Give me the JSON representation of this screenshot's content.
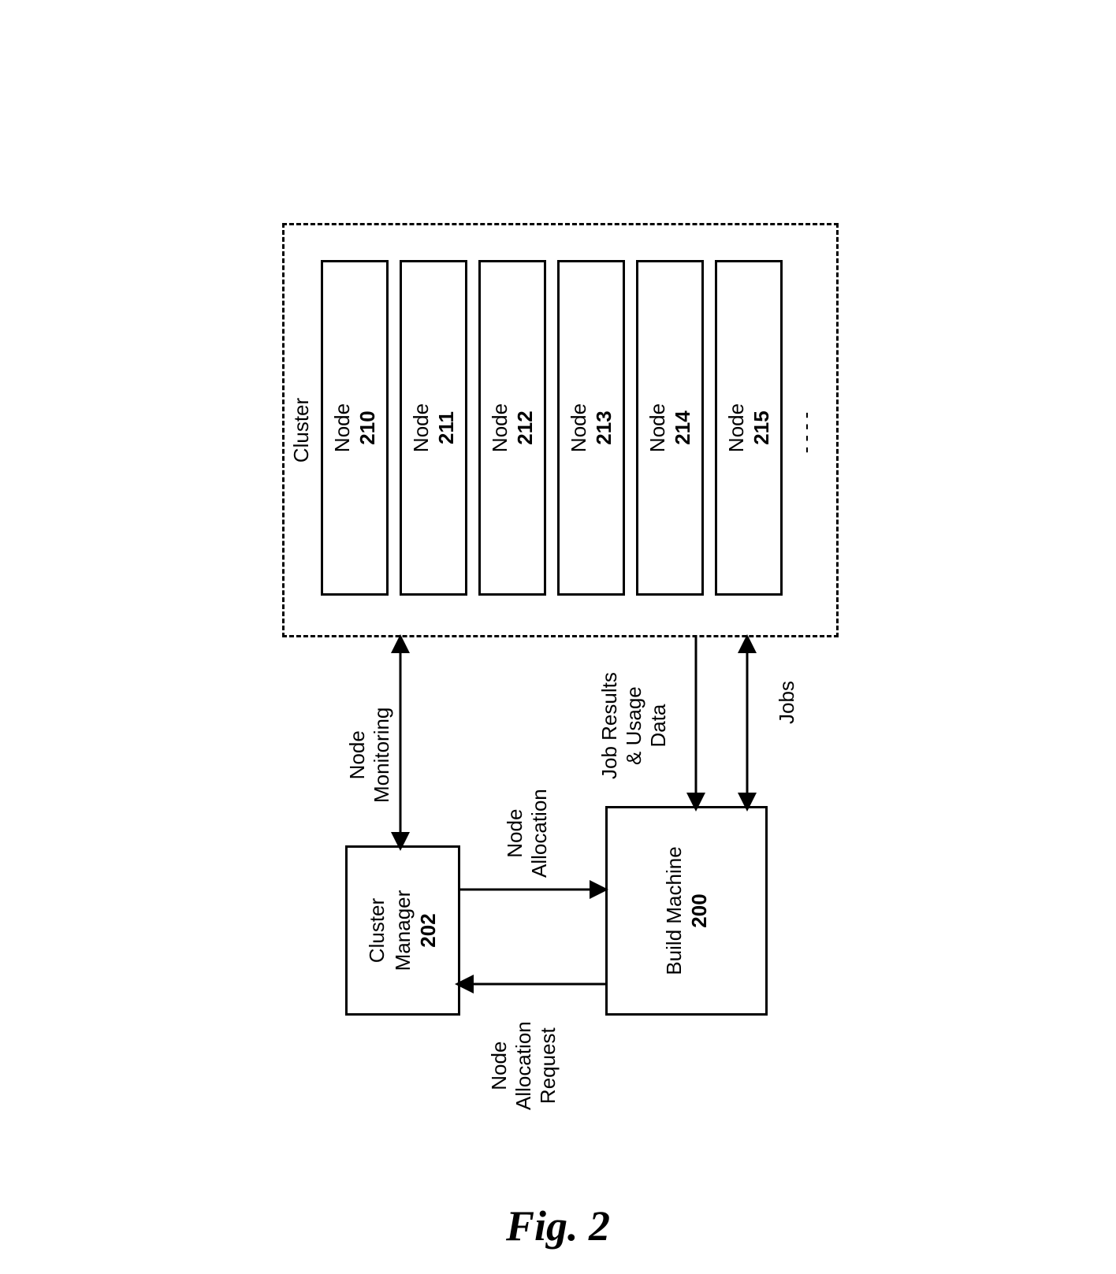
{
  "figureCaption": "Fig. 2",
  "clusterManager": {
    "label": "Cluster\nManager",
    "num": "202"
  },
  "buildMachine": {
    "label": "Build Machine",
    "num": "200"
  },
  "cluster": {
    "title": "Cluster",
    "nodes": [
      {
        "label": "Node",
        "num": "210"
      },
      {
        "label": "Node",
        "num": "211"
      },
      {
        "label": "Node",
        "num": "212"
      },
      {
        "label": "Node",
        "num": "213"
      },
      {
        "label": "Node",
        "num": "214"
      },
      {
        "label": "Node",
        "num": "215"
      }
    ],
    "ellipsis": "----"
  },
  "labels": {
    "nodeAllocRequest": "Node\nAllocation\nRequest",
    "nodeAllocation": "Node\nAllocation",
    "nodeMonitoring": "Node\nMonitoring",
    "jobResults": "Job Results\n& Usage\nData",
    "jobs": "Jobs"
  }
}
